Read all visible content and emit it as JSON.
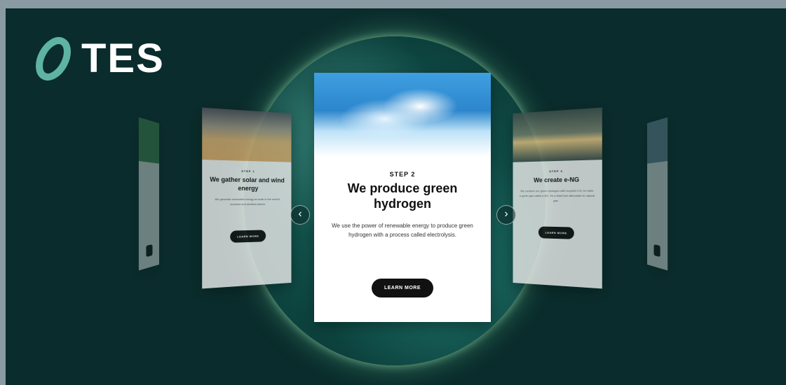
{
  "brand": {
    "name": "TES",
    "accent": "#5fb3a3",
    "background": "#0a2c2c"
  },
  "carousel": {
    "main": {
      "step": "STEP 2",
      "title": "We produce green hydrogen",
      "description": "We use the power of renewable energy to produce green hydrogen with a process called electrolysis.",
      "button": "LEARN MORE",
      "image": "water-splash-image"
    },
    "left": {
      "step": "STEP 1",
      "title": "We gather solar and wind energy",
      "description": "We generate renewable energy at scale in the world's sunniest and windiest places.",
      "button": "LEARN MORE",
      "image": "solar-panels-image"
    },
    "right": {
      "step": "STEP 3",
      "title": "We create e-NG",
      "description": "We combine our green hydrogen with recycled CO₂ to make e-green gas called e-NG. It's a fossil fuel alternative to natural gas.",
      "button": "LEARN MORE",
      "image": "sea-sunset-image"
    },
    "prev_icon": "chevron-left-icon",
    "next_icon": "chevron-right-icon"
  }
}
